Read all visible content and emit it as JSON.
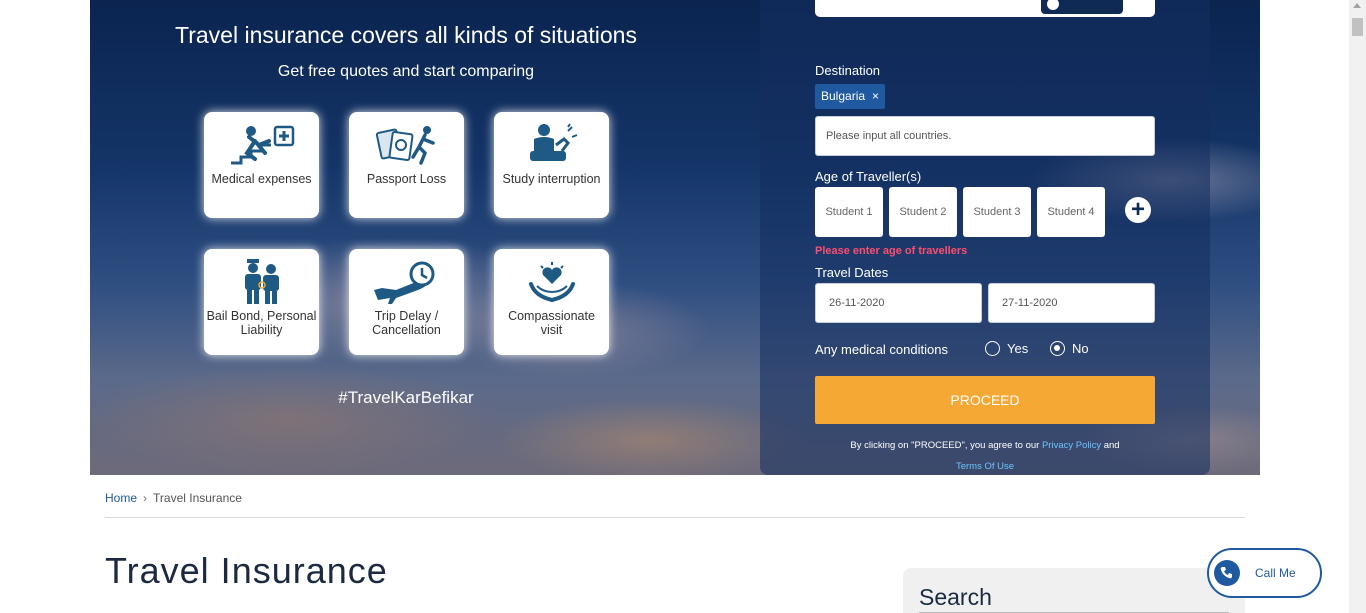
{
  "hero": {
    "title": "Travel insurance covers all kinds of situations",
    "subtitle": "Get free quotes and start comparing",
    "hashtag": "#TravelKarBefikar",
    "tiles": [
      {
        "label": "Medical expenses",
        "icon": "medical-fall-icon"
      },
      {
        "label": "Passport Loss",
        "icon": "passport-loss-icon"
      },
      {
        "label": "Study interruption",
        "icon": "study-interruption-icon"
      },
      {
        "label": "Bail Bond, Personal Liability",
        "icon": "bail-bond-icon"
      },
      {
        "label": "Trip Delay / Cancellation",
        "icon": "plane-clock-icon"
      },
      {
        "label": "Compassionate visit",
        "icon": "heart-hands-icon"
      }
    ]
  },
  "form": {
    "destination_label": "Destination",
    "destination_chip": "Bulgaria",
    "chip_remove": "×",
    "countries_placeholder": "Please input all countries.",
    "age_label": "Age of Traveller(s)",
    "travellers": [
      "Student 1",
      "Student 2",
      "Student 3",
      "Student 4"
    ],
    "add_traveller": "+",
    "age_error": "Please enter age of travellers",
    "dates_label": "Travel Dates",
    "start_date": "26-11-2020",
    "end_date": "27-11-2020",
    "medical_label": "Any medical conditions",
    "medical_yes": "Yes",
    "medical_no": "No",
    "medical_selected": "No",
    "proceed_label": "PROCEED",
    "agree_text": "By clicking on \"PROCEED\", you agree to our",
    "privacy_link": "Privacy Policy",
    "and_text": "and",
    "terms_link": "Terms Of Use"
  },
  "breadcrumb": {
    "home": "Home",
    "sep": "›",
    "current": "Travel Insurance"
  },
  "page": {
    "title": "Travel Insurance"
  },
  "sidebar": {
    "search_title": "Search"
  },
  "callme": {
    "label": "Call Me"
  },
  "colors": {
    "accent": "#f5a833",
    "link": "#1f5aa0",
    "error": "#ff4d6d",
    "navy": "#0f2a55"
  }
}
